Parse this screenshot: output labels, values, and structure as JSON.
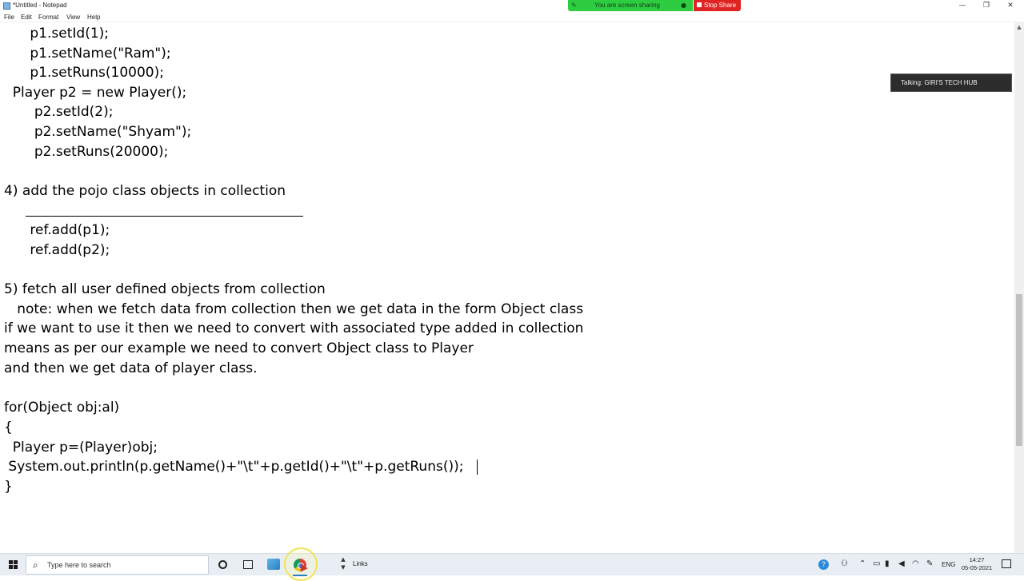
{
  "window": {
    "title": "*Untitled - Notepad",
    "minimize": "—",
    "maximize": "❐",
    "close": "✕"
  },
  "menu": [
    "File",
    "Edit",
    "Format",
    "View",
    "Help"
  ],
  "screen_share": {
    "status": "You are screen sharing",
    "stop_label": "Stop Share",
    "color_active": "#2ecc40",
    "color_stop": "#e02424"
  },
  "talking_indicator": "Talking: GIRI'S TECH HUB",
  "editor": {
    "lines": [
      "      p1.setId(1);",
      "      p1.setName(\"Ram\");",
      "      p1.setRuns(10000);",
      "  Player p2 = new Player();",
      "       p2.setId(2);",
      "       p2.setName(\"Shyam\");",
      "       p2.setRuns(20000);",
      "",
      "4) add the pojo class objects in collection",
      "",
      "      ref.add(p1);",
      "      ref.add(p2);",
      "",
      "5) fetch all user defined objects from collection",
      "   note: when we fetch data from collection then we get data in the form Object class",
      "if we want to use it then we need to convert with associated type added in collection",
      "means as per our example we need to convert Object class to Player",
      "and then we get data of player class.",
      "",
      "for(Object obj:al)",
      "{",
      "  Player p=(Player)obj;",
      " System.out.println(p.getName()+\"\\t\"+p.getId()+\"\\t\"+p.getRuns());",
      "}"
    ]
  },
  "taskbar": {
    "search_placeholder": "Type here to search",
    "links_label": "Links",
    "language": "ENG",
    "time": "14:27",
    "date": "05-05-2021",
    "icons": [
      "windows-start-icon",
      "search-icon",
      "cortana-icon",
      "task-view-icon",
      "paint-app-icon",
      "chrome-app-icon"
    ]
  }
}
